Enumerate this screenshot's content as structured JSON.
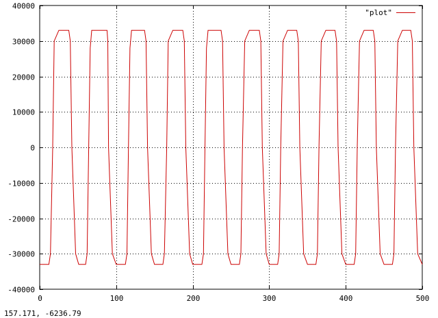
{
  "status": {
    "coords": "157.171, -6236.79"
  },
  "colors": {
    "series": "#cc0000",
    "axis": "#000000",
    "grid": "#000000",
    "background": "#ffffff"
  },
  "chart_data": {
    "type": "line",
    "title": "",
    "xlabel": "",
    "ylabel": "",
    "xlim": [
      0,
      500
    ],
    "ylim": [
      -40000,
      40000
    ],
    "grid": true,
    "legend_position": "top-right",
    "x_ticks": [
      0,
      100,
      200,
      300,
      400,
      500
    ],
    "y_ticks": [
      -40000,
      -30000,
      -20000,
      -10000,
      0,
      10000,
      20000,
      30000,
      40000
    ],
    "x_tick_labels": [
      "0",
      "100",
      "200",
      "300",
      "400",
      "500"
    ],
    "y_tick_labels": [
      "-40000",
      "-30000",
      "-20000",
      "-10000",
      "0",
      "10000",
      "20000",
      "30000",
      "40000"
    ],
    "series": [
      {
        "name": "\"plot\"",
        "x": [
          0,
          12,
          14,
          17,
          19,
          25,
          38,
          40,
          42,
          47,
          51,
          60,
          62,
          64,
          66,
          68,
          74,
          88,
          89,
          90,
          95,
          100,
          112,
          114,
          116,
          118,
          120,
          124,
          137,
          139,
          141,
          146,
          150,
          161,
          163,
          166,
          168,
          174,
          187,
          189,
          191,
          196,
          200,
          212,
          214,
          216,
          218,
          220,
          224,
          237,
          239,
          241,
          246,
          250,
          261,
          263,
          265,
          268,
          274,
          287,
          289,
          291,
          296,
          300,
          311,
          313,
          315,
          318,
          324,
          336,
          338,
          340,
          345,
          350,
          361,
          363,
          365,
          368,
          374,
          386,
          388,
          390,
          395,
          400,
          411,
          413,
          415,
          418,
          424,
          436,
          438,
          440,
          445,
          450,
          461,
          463,
          465,
          468,
          474,
          485,
          487,
          489,
          494,
          500
        ],
        "y": [
          -33000,
          -33000,
          -30000,
          0,
          30000,
          33000,
          33000,
          30000,
          0,
          -30000,
          -33000,
          -33000,
          -30000,
          0,
          28000,
          33000,
          33000,
          33000,
          30000,
          0,
          -30000,
          -33000,
          -33000,
          -30000,
          0,
          28000,
          33000,
          33000,
          33000,
          30000,
          0,
          -30000,
          -33000,
          -33000,
          -30000,
          0,
          30000,
          33000,
          33000,
          30000,
          0,
          -30000,
          -33000,
          -33000,
          -30000,
          0,
          28000,
          33000,
          33000,
          33000,
          30000,
          0,
          -30000,
          -33000,
          -33000,
          -30000,
          0,
          30000,
          33000,
          33000,
          30000,
          0,
          -30000,
          -33000,
          -33000,
          -30000,
          0,
          30000,
          33000,
          33000,
          30000,
          0,
          -30000,
          -33000,
          -33000,
          -30000,
          0,
          30000,
          33000,
          33000,
          30000,
          0,
          -30000,
          -33000,
          -33000,
          -30000,
          0,
          30000,
          33000,
          33000,
          30000,
          0,
          -30000,
          -33000,
          -33000,
          -30000,
          0,
          30000,
          33000,
          33000,
          30000,
          0,
          -30000,
          -33000
        ]
      }
    ]
  }
}
